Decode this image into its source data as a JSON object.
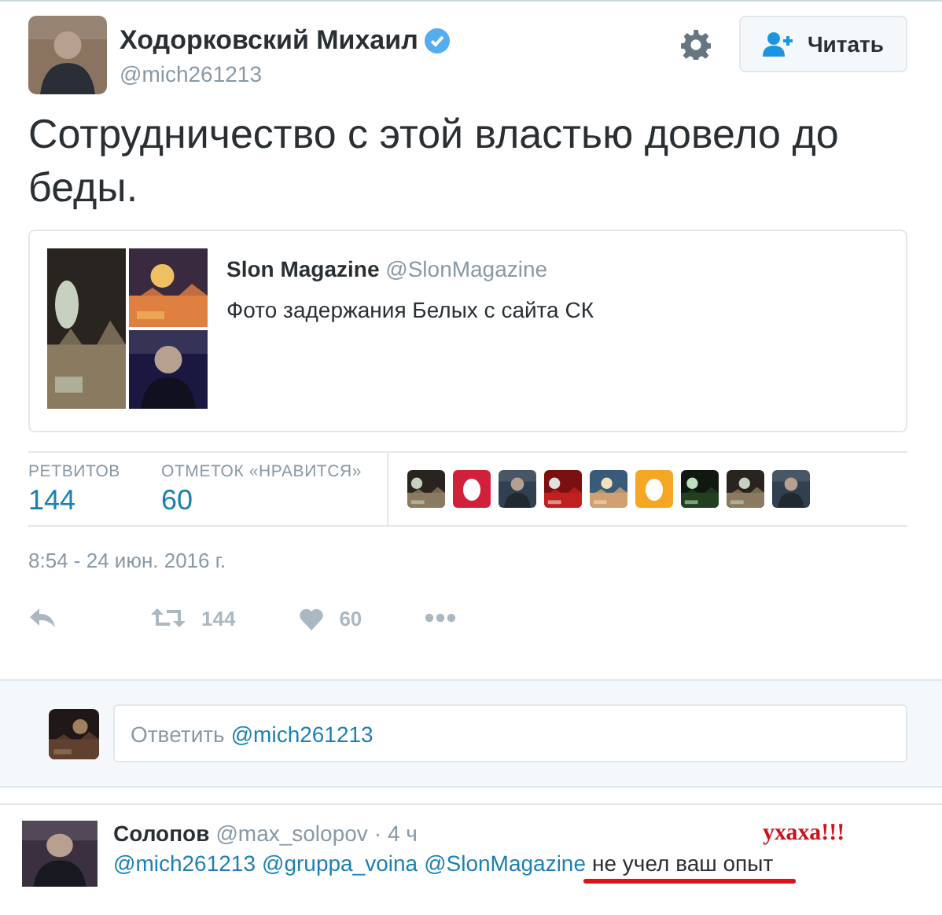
{
  "author": {
    "name": "Ходорковский Михаил",
    "verified": true,
    "handle": "@mich261213"
  },
  "follow_button": {
    "label": "Читать"
  },
  "tweet_text": "Сотрудничество с этой властью довело до беды.",
  "quoted": {
    "name": "Slon Magazine",
    "handle": "@SlonMagazine",
    "text": "Фото задержания Белых с сайта СК"
  },
  "stats": [
    {
      "label": "РЕТВИТОВ",
      "value": "144"
    },
    {
      "label": "ОТМЕТОК «НРАВИТСЯ»",
      "value": "60"
    }
  ],
  "likers": [
    {
      "kind": "picture"
    },
    {
      "kind": "egg",
      "color": "#d0203a"
    },
    {
      "kind": "picture"
    },
    {
      "kind": "picture"
    },
    {
      "kind": "picture"
    },
    {
      "kind": "egg",
      "color": "#f5a623"
    },
    {
      "kind": "picture"
    },
    {
      "kind": "picture"
    },
    {
      "kind": "picture"
    }
  ],
  "timestamp": "8:54 - 24 июн. 2016 г.",
  "actions": [
    {
      "kind": "reply"
    },
    {
      "kind": "retweet",
      "count": "144"
    },
    {
      "kind": "like",
      "count": "60"
    },
    {
      "kind": "more"
    }
  ],
  "reply_box": {
    "prefix": "Ответить",
    "mention": "@mich261213"
  },
  "reply": {
    "name": "Солопов",
    "handle": "@max_solopov",
    "time": "· 4 ч",
    "mentions": [
      "@mich261213",
      "@gruppa_voina",
      "@SlonMagazine"
    ],
    "text": "не учел ваш опыт"
  },
  "annotation": {
    "text": "ухаха!!!"
  }
}
